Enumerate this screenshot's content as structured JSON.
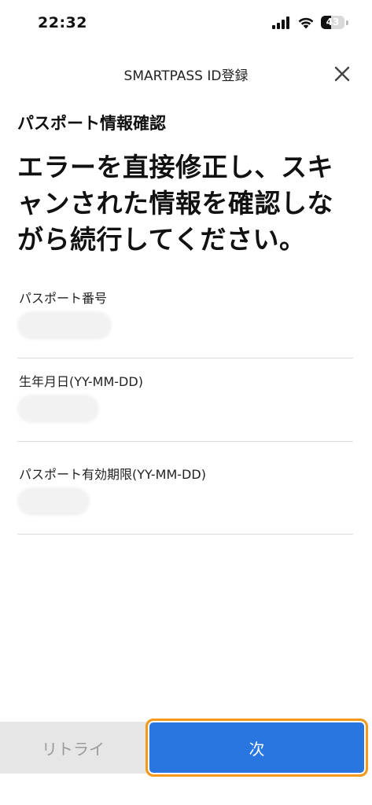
{
  "status_bar": {
    "time": "22:32",
    "signal_icon": "cellular-signal-icon",
    "wifi_icon": "wifi-icon",
    "battery_icon": "battery-icon",
    "battery_level": "43"
  },
  "header": {
    "title": "SMARTPASS ID登録",
    "close_icon": "close-icon"
  },
  "main": {
    "section_title": "パスポート情報確認",
    "instruction": "エラーを直接修正し、スキャンされた情報を確認しながら続行してください。",
    "fields": [
      {
        "label": "パスポート番号"
      },
      {
        "label": "生年月日(YY-MM-DD)"
      },
      {
        "label": "パスポート有効期限(YY-MM-DD)"
      }
    ]
  },
  "footer": {
    "retry_label": "リトライ",
    "next_label": "次"
  },
  "colors": {
    "primary": "#2a76e0",
    "highlight_border": "#f39a1b",
    "retry_bg": "#e6e6e6",
    "retry_text": "#9a9a9a"
  }
}
